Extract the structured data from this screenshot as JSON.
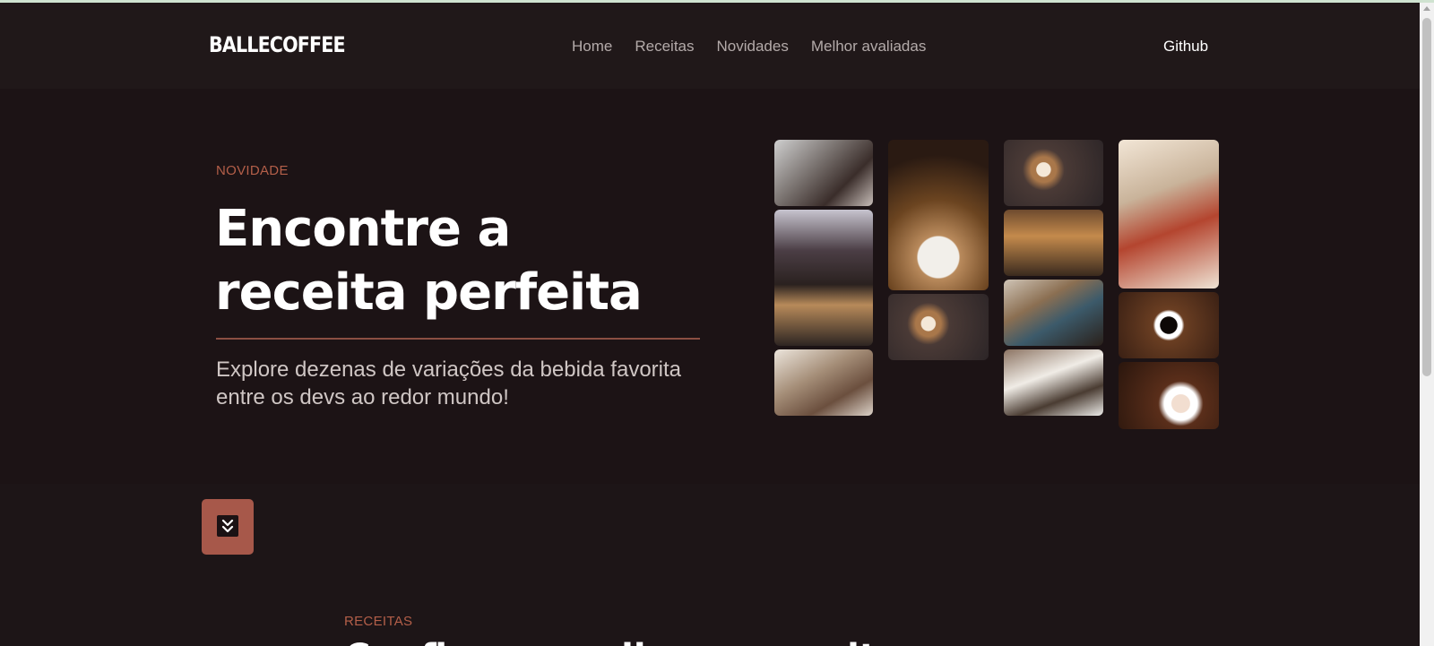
{
  "navbar": {
    "brand": "BALLECOFFEE",
    "links": [
      "Home",
      "Receitas",
      "Novidades",
      "Melhor avaliadas"
    ],
    "github": "Github"
  },
  "hero": {
    "eyebrow": "NOVIDADE",
    "title": "Encontre a receita perfeita",
    "subtitle": "Explore dezenas de variações da bebida favorita entre os devs ao redor mundo!"
  },
  "scroll_button": {
    "icon": "chevrons-down-icon"
  },
  "recipes": {
    "eyebrow": "RECEITAS",
    "title": "Confira as melhores receitas"
  },
  "colors": {
    "background": "#1c1315",
    "navbar": "#201819",
    "accent": "#b45f49",
    "button": "#a7584a"
  }
}
